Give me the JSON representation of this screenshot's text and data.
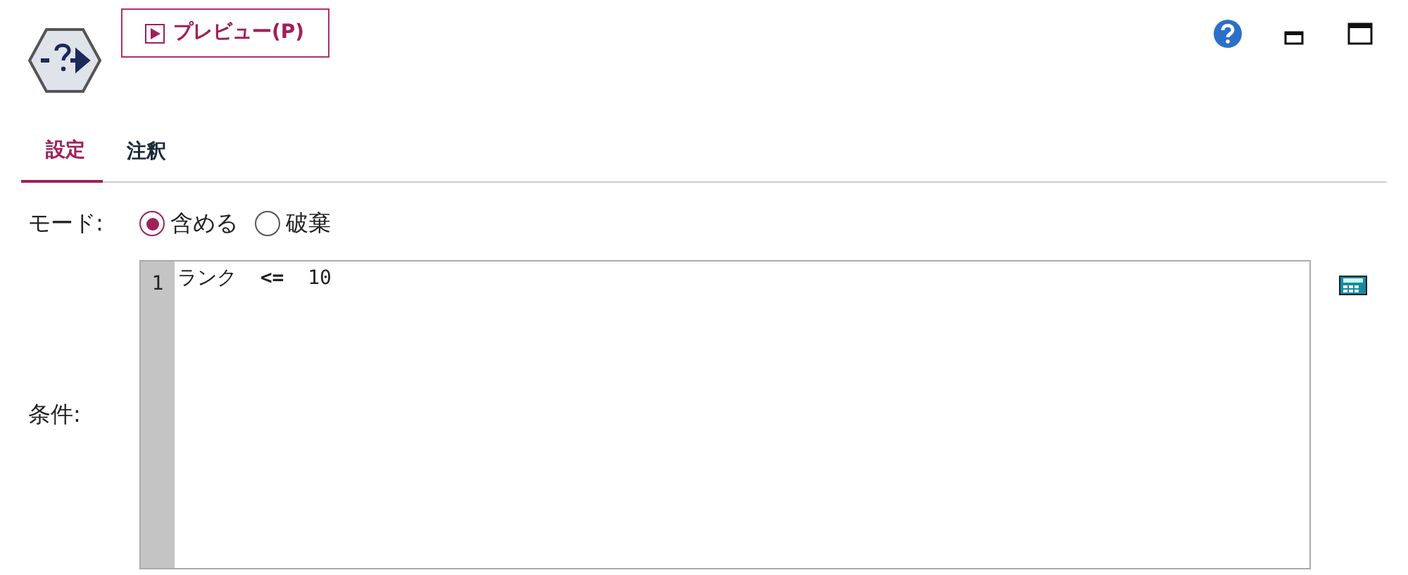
{
  "toolbar": {
    "preview_button": "プレビュー(P)"
  },
  "tabs": [
    {
      "label": "設定",
      "selected": true
    },
    {
      "label": "注釈",
      "selected": false
    }
  ],
  "mode": {
    "label": "モード:",
    "options": [
      {
        "label": "含める",
        "selected": true
      },
      {
        "label": "破棄",
        "selected": false
      }
    ]
  },
  "condition": {
    "label": "条件:",
    "lines": [
      {
        "number": "1",
        "text": "ランク  **<=**  10"
      }
    ]
  }
}
